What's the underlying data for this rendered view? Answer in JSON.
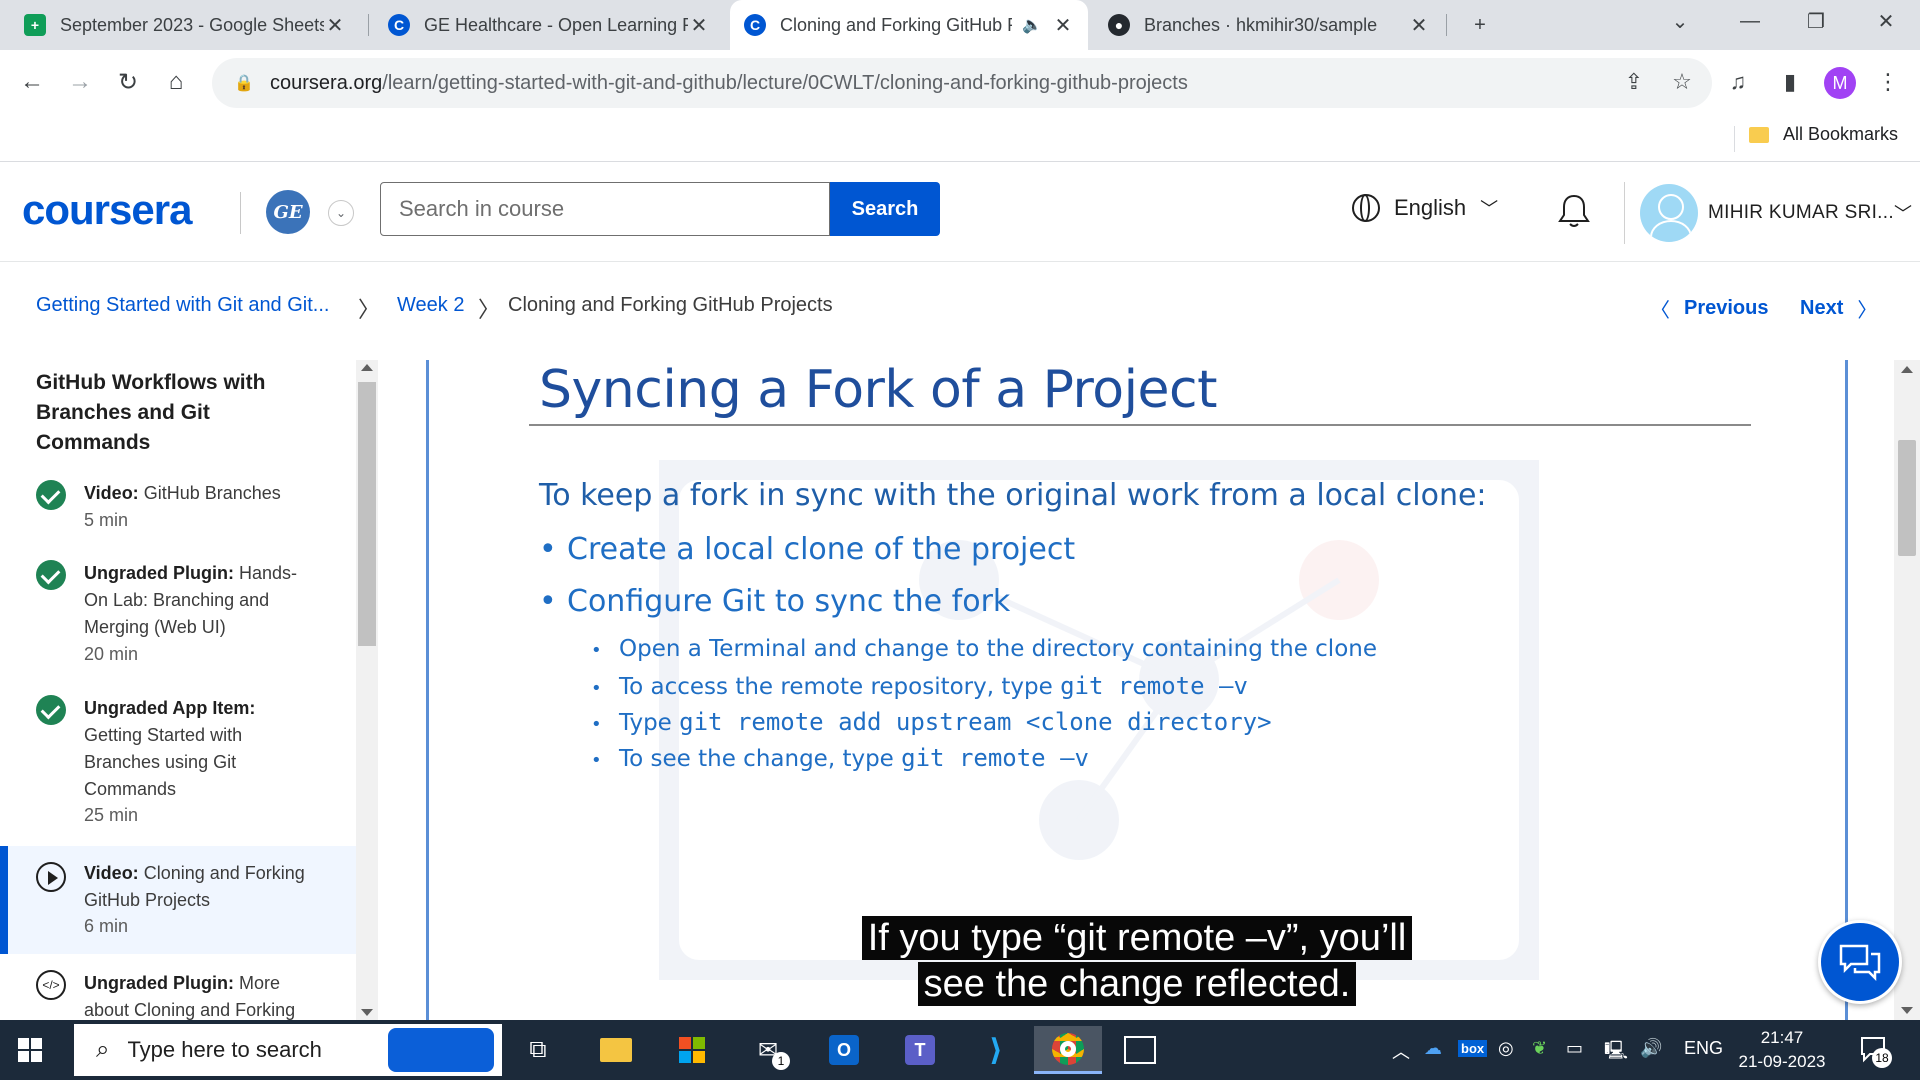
{
  "browser": {
    "tabs": [
      {
        "title": "September 2023 - Google Sheets",
        "icon": "sheets-icon",
        "active": false
      },
      {
        "title": "GE Healthcare - Open Learning Project",
        "icon": "coursera-icon",
        "active": false
      },
      {
        "title": "Cloning and Forking GitHub Projects",
        "icon": "coursera-icon",
        "active": true
      },
      {
        "title": "Branches · hkmihir30/sample",
        "icon": "github-icon",
        "active": false
      }
    ],
    "url_domain": "coursera.org",
    "url_path": "/learn/getting-started-with-git-and-github/lecture/0CWLT/cloning-and-forking-github-projects",
    "profile_initial": "M",
    "bookmarks_label": "All Bookmarks"
  },
  "header": {
    "logo": "coursera",
    "partner_logo": "GE",
    "search_placeholder": "Search in course",
    "search_button": "Search",
    "language": "English",
    "username": "MIHIR KUMAR SRI..."
  },
  "breadcrumb": {
    "course": "Getting Started with Git and Git...",
    "week": "Week 2",
    "current": "Cloning and Forking GitHub Projects",
    "previous": "Previous",
    "next": "Next"
  },
  "sidebar": {
    "module_title": "GitHub Workflows with Branches and Git Commands",
    "items": [
      {
        "type": "Video:",
        "title": "GitHub Branches",
        "duration": "5 min",
        "status": "completed"
      },
      {
        "type": "Ungraded Plugin:",
        "title": "Hands-On Lab: Branching and Merging (Web UI)",
        "duration": "20 min",
        "status": "completed"
      },
      {
        "type": "Ungraded App Item:",
        "title": "Getting Started with Branches using Git Commands",
        "duration": "25 min",
        "status": "completed"
      },
      {
        "type": "Video:",
        "title": "Cloning and Forking GitHub Projects",
        "duration": "6 min",
        "status": "current"
      },
      {
        "type": "Ungraded Plugin:",
        "title": "More about Cloning and Forking",
        "duration": "",
        "status": "pending"
      }
    ]
  },
  "slide": {
    "title": "Syncing a Fork of a Project",
    "lead": "To keep a fork in sync with the original work from a local clone:",
    "bullets": [
      "Create a local clone of the project",
      "Configure Git to sync the fork"
    ],
    "sub_bullets": [
      {
        "text": "Open a Terminal and change to the directory containing the clone",
        "code": ""
      },
      {
        "text": "To access the remote repository, type ",
        "code": "git remote –v"
      },
      {
        "text": "Type ",
        "code": "git remote add upstream <clone directory>"
      },
      {
        "text": "To see the change, type ",
        "code": "git remote –v"
      }
    ],
    "caption_line1": "If you type “git remote –v”, you’ll",
    "caption_line2": "see the change reflected."
  },
  "taskbar": {
    "search_placeholder": "Type here to search",
    "language": "ENG",
    "time": "21:47",
    "date": "21-09-2023",
    "notification_count": "18",
    "mail_badge": "1"
  },
  "colors": {
    "brand": "#0056d2",
    "completed": "#1f8354",
    "slide_title": "#1f4e9c",
    "slide_text": "#1f6ec4"
  }
}
